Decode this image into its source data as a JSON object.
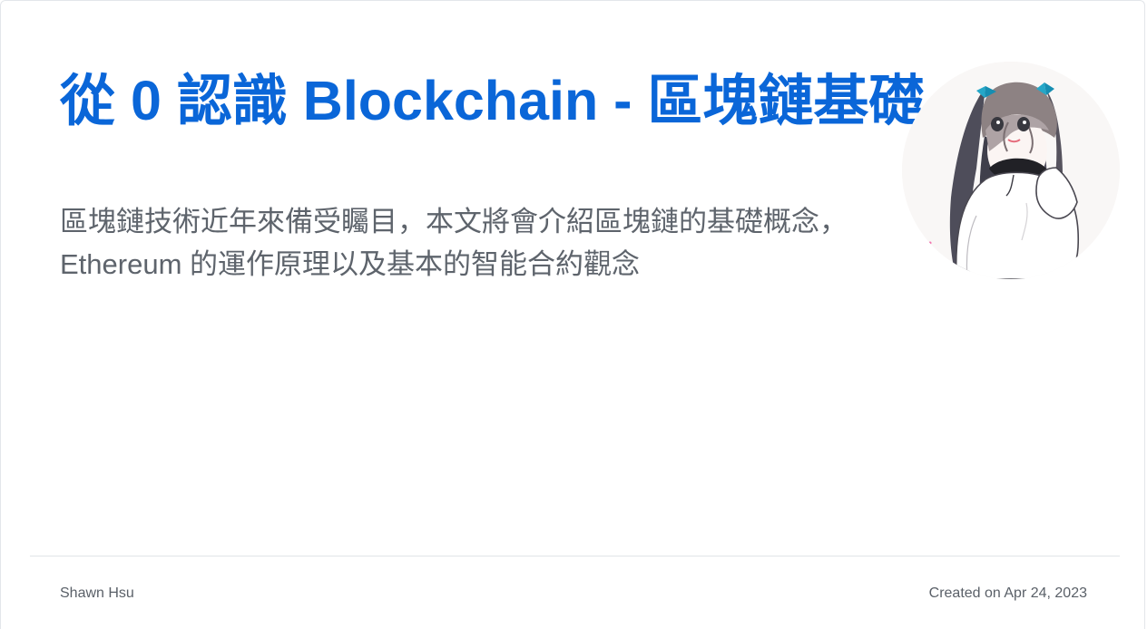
{
  "post": {
    "title": "從 0 認識 Blockchain - 區塊鏈基礎",
    "description": "區塊鏈技術近年來備受矚目，本文將會介紹區塊鏈的基礎概念，Ethereum 的運作原理以及基本的智能合約觀念",
    "author": "Shawn Hsu",
    "created_prefix": "Created on",
    "created_date": "Apr 24, 2023"
  },
  "avatar": {
    "icon": "anime-girl-avatar-icon"
  },
  "colors": {
    "title": "#0a66d8",
    "text": "#5e646c",
    "divider": "#e1e4e8"
  }
}
